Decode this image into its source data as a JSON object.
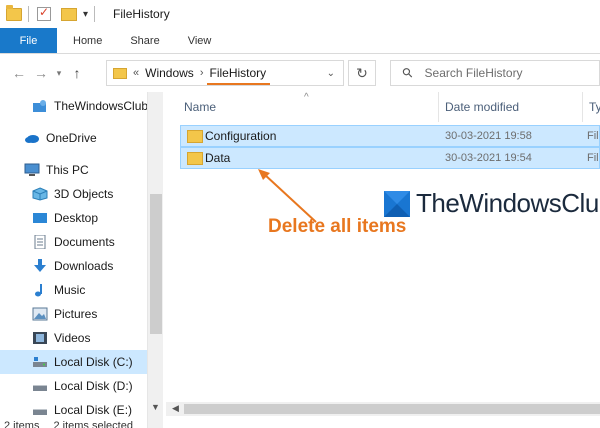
{
  "window": {
    "title": "FileHistory"
  },
  "ribbon": {
    "tabs": [
      "File",
      "Home",
      "Share",
      "View"
    ]
  },
  "address": {
    "overflow": "«",
    "breadcrumbs": [
      "Windows",
      "FileHistory"
    ]
  },
  "search": {
    "placeholder": "Search FileHistory"
  },
  "sidebar": {
    "items": [
      {
        "label": "TheWindowsClub",
        "icon": "user-folder-icon"
      },
      {
        "label": "OneDrive",
        "icon": "cloud-icon"
      },
      {
        "label": "This PC",
        "icon": "computer-icon"
      },
      {
        "label": "3D Objects",
        "icon": "cube-icon"
      },
      {
        "label": "Desktop",
        "icon": "desktop-icon"
      },
      {
        "label": "Documents",
        "icon": "document-icon"
      },
      {
        "label": "Downloads",
        "icon": "download-icon"
      },
      {
        "label": "Music",
        "icon": "music-icon"
      },
      {
        "label": "Pictures",
        "icon": "picture-icon"
      },
      {
        "label": "Videos",
        "icon": "video-icon"
      },
      {
        "label": "Local Disk (C:)",
        "icon": "drive-icon",
        "selected": true
      },
      {
        "label": "Local Disk (D:)",
        "icon": "drive-icon"
      },
      {
        "label": "Local Disk (E:)",
        "icon": "drive-icon"
      }
    ]
  },
  "columns": {
    "name": "Name",
    "date": "Date modified",
    "type": "Ty"
  },
  "files": [
    {
      "name": "Configuration",
      "date": "30-03-2021 19:58",
      "type": "Fil"
    },
    {
      "name": "Data",
      "date": "30-03-2021 19:54",
      "type": "Fil"
    }
  ],
  "annotation": {
    "text": "Delete all items",
    "color": "#e8771f"
  },
  "watermark": {
    "text": "TheWindowsClub"
  },
  "status": {
    "count": "2 items",
    "selected": "2 items selected"
  },
  "colors": {
    "accent": "#1979ca",
    "selection": "#cce8ff",
    "selection_border": "#99d1ff"
  }
}
